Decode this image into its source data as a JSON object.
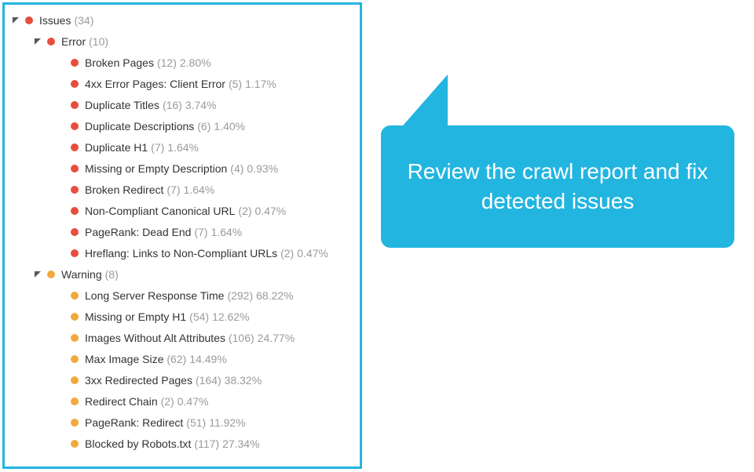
{
  "callout": {
    "text": "Review the crawl report and fix detected issues"
  },
  "tree": {
    "root": {
      "label": "Issues",
      "count": "(34)",
      "expanded": true
    },
    "groups": [
      {
        "label": "Error",
        "count": "(10)",
        "expanded": true,
        "severity": "red",
        "items": [
          {
            "label": "Broken Pages",
            "count": "(12)",
            "pct": "2.80%"
          },
          {
            "label": "4xx Error Pages: Client Error",
            "count": "(5)",
            "pct": "1.17%"
          },
          {
            "label": "Duplicate Titles",
            "count": "(16)",
            "pct": "3.74%"
          },
          {
            "label": "Duplicate Descriptions",
            "count": "(6)",
            "pct": "1.40%"
          },
          {
            "label": "Duplicate H1",
            "count": "(7)",
            "pct": "1.64%"
          },
          {
            "label": "Missing or Empty Description",
            "count": "(4)",
            "pct": "0.93%"
          },
          {
            "label": "Broken Redirect",
            "count": "(7)",
            "pct": "1.64%"
          },
          {
            "label": "Non-Compliant Canonical URL",
            "count": "(2)",
            "pct": "0.47%"
          },
          {
            "label": "PageRank: Dead End",
            "count": "(7)",
            "pct": "1.64%"
          },
          {
            "label": "Hreflang: Links to Non-Compliant URLs",
            "count": "(2)",
            "pct": "0.47%"
          }
        ]
      },
      {
        "label": "Warning",
        "count": "(8)",
        "expanded": true,
        "severity": "orange",
        "items": [
          {
            "label": "Long Server Response Time",
            "count": "(292)",
            "pct": "68.22%"
          },
          {
            "label": "Missing or Empty H1",
            "count": "(54)",
            "pct": "12.62%"
          },
          {
            "label": "Images Without Alt Attributes",
            "count": "(106)",
            "pct": "24.77%"
          },
          {
            "label": "Max Image Size",
            "count": "(62)",
            "pct": "14.49%"
          },
          {
            "label": "3xx Redirected Pages",
            "count": "(164)",
            "pct": "38.32%"
          },
          {
            "label": "Redirect Chain",
            "count": "(2)",
            "pct": "0.47%"
          },
          {
            "label": "PageRank: Redirect",
            "count": "(51)",
            "pct": "11.92%"
          },
          {
            "label": "Blocked by Robots.txt",
            "count": "(117)",
            "pct": "27.34%"
          }
        ]
      }
    ]
  }
}
